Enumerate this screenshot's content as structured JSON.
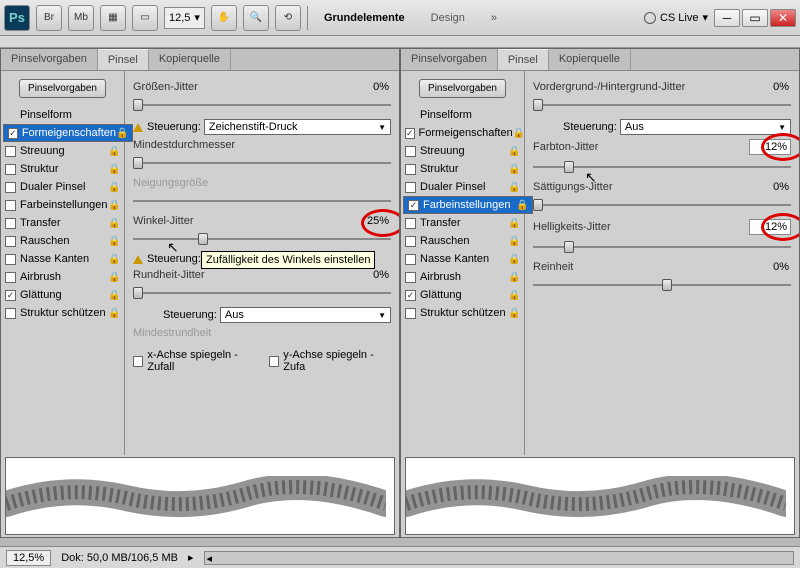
{
  "topbar": {
    "ps": "Ps",
    "br": "Br",
    "mb": "Mb",
    "zoom": "12,5",
    "tab_active": "Grundelemente",
    "tab_design": "Design",
    "cs_live": "CS Live"
  },
  "panel_tabs": {
    "t1": "Pinselvorgaben",
    "t2": "Pinsel",
    "t3": "Kopierquelle"
  },
  "preset_button": "Pinselvorgaben",
  "sidebar": {
    "pinselform": "Pinselform",
    "formeig": "Formeigenschaften",
    "streuung": "Streuung",
    "struktur": "Struktur",
    "dualer": "Dualer Pinsel",
    "farbein": "Farbeinstellungen",
    "transfer": "Transfer",
    "rauschen": "Rauschen",
    "nasse": "Nasse Kanten",
    "airbrush": "Airbrush",
    "glaettung": "Glättung",
    "strukturs": "Struktur schützen"
  },
  "left": {
    "groessen": "Größen-Jitter",
    "groessen_val": "0%",
    "steuerung": "Steuerung:",
    "steuerung_val": "Zeichenstift-Druck",
    "mindest": "Mindestdurchmesser",
    "neigung": "Neigungsgröße",
    "winkel": "Winkel-Jitter",
    "winkel_val": "25%",
    "rundheit": "Rundheit-Jitter",
    "rundheit_val": "0%",
    "steuerung2_val": "Aus",
    "mindestrund": "Mindestrundheit",
    "xachse": "x-Achse spiegeln - Zufall",
    "yachse": "y-Achse spiegeln - Zufa",
    "tooltip": "Zufälligkeit des Winkels einstellen"
  },
  "right": {
    "vorder": "Vordergrund-/Hintergrund-Jitter",
    "vorder_val": "0%",
    "steuerung": "Steuerung:",
    "steuerung_val": "Aus",
    "farbton": "Farbton-Jitter",
    "farbton_val": "12%",
    "saett": "Sättigungs-Jitter",
    "saett_val": "0%",
    "hellig": "Helligkeits-Jitter",
    "hellig_val": "12%",
    "rein": "Reinheit",
    "rein_val": "0%"
  },
  "statusbar": {
    "zoom": "12,5%",
    "dok": "Dok: 50,0 MB/106,5 MB"
  }
}
